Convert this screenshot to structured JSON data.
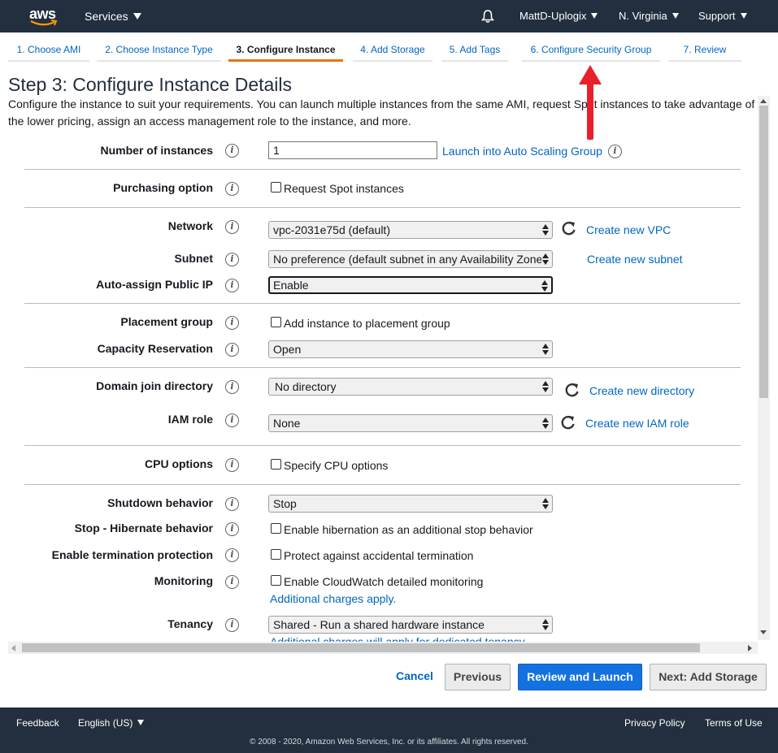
{
  "nav": {
    "logo_text": "aws",
    "services": "Services",
    "account": "MattD-Uplogix",
    "region": "N. Virginia",
    "support": "Support"
  },
  "tabs": [
    {
      "label": "1. Choose AMI",
      "active": false
    },
    {
      "label": "2. Choose Instance Type",
      "active": false
    },
    {
      "label": "3. Configure Instance",
      "active": true
    },
    {
      "label": "4. Add Storage",
      "active": false
    },
    {
      "label": "5. Add Tags",
      "active": false
    },
    {
      "label": "6. Configure Security Group",
      "active": false
    },
    {
      "label": "7. Review",
      "active": false
    }
  ],
  "page": {
    "title": "Step 3: Configure Instance Details",
    "description": "Configure the instance to suit your requirements. You can launch multiple instances from the same AMI, request Spot instances to take advantage of the lower pricing, assign an access management role to the instance, and more."
  },
  "form": {
    "instances": {
      "label": "Number of instances",
      "value": "1",
      "link": "Launch into Auto Scaling Group"
    },
    "purchasing": {
      "label": "Purchasing option",
      "checkbox": "Request Spot instances",
      "checked": false
    },
    "network": {
      "label": "Network",
      "value": "vpc-2031e75d (default)",
      "link": "Create new VPC"
    },
    "subnet": {
      "label": "Subnet",
      "value": "No preference (default subnet in any Availability Zone)",
      "link": "Create new subnet"
    },
    "public_ip": {
      "label": "Auto-assign Public IP",
      "value": "Enable"
    },
    "placement": {
      "label": "Placement group",
      "checkbox": "Add instance to placement group",
      "checked": false
    },
    "capacity": {
      "label": "Capacity Reservation",
      "value": "Open"
    },
    "domain": {
      "label": "Domain join directory",
      "value": "No directory",
      "link": "Create new directory"
    },
    "iam": {
      "label": "IAM role",
      "value": "None",
      "link": "Create new IAM role"
    },
    "cpu": {
      "label": "CPU options",
      "checkbox": "Specify CPU options",
      "checked": false
    },
    "shutdown": {
      "label": "Shutdown behavior",
      "value": "Stop"
    },
    "hibernate": {
      "label": "Stop - Hibernate behavior",
      "checkbox": "Enable hibernation as an additional stop behavior",
      "checked": false
    },
    "termination": {
      "label": "Enable termination protection",
      "checkbox": "Protect against accidental termination",
      "checked": false
    },
    "monitoring": {
      "label": "Monitoring",
      "checkbox": "Enable CloudWatch detailed monitoring",
      "checked": false,
      "note": "Additional charges apply."
    },
    "tenancy": {
      "label": "Tenancy",
      "value": "Shared - Run a shared hardware instance",
      "note": "Additional charges will apply for dedicated tenancy."
    }
  },
  "buttons": {
    "cancel": "Cancel",
    "previous": "Previous",
    "review": "Review and Launch",
    "next": "Next: Add Storage"
  },
  "footer": {
    "feedback": "Feedback",
    "language": "English (US)",
    "privacy": "Privacy Policy",
    "terms": "Terms of Use",
    "copyright": "© 2008 - 2020, Amazon Web Services, Inc. or its affiliates. All rights reserved."
  },
  "colors": {
    "nav_bg": "#232f3e",
    "active_tab": "#ec7211",
    "link": "#0066c0",
    "primary_button": "#1472e0",
    "annotation_arrow": "#e8202a"
  },
  "annotation": {
    "icon": "red-arrow-up-icon"
  }
}
